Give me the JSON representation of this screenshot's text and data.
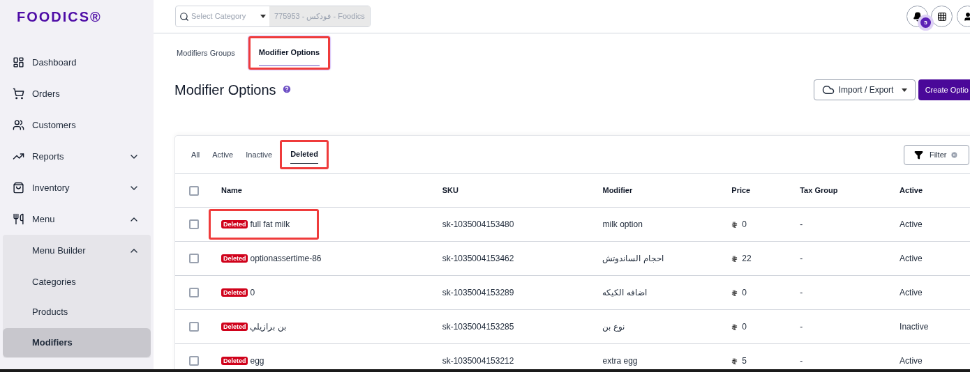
{
  "sidebar": {
    "logo": "FOODICS®",
    "items": [
      {
        "label": "Dashboard",
        "selected": false
      },
      {
        "label": "Orders",
        "selected": false
      },
      {
        "label": "Customers",
        "selected": false
      },
      {
        "label": "Reports",
        "selected": false,
        "expanded": false
      },
      {
        "label": "Inventory",
        "selected": false,
        "expanded": false
      },
      {
        "label": "Menu",
        "selected": false,
        "expanded": true,
        "children": [
          {
            "label": "Menu Builder",
            "selected": false,
            "expanded": true,
            "children": [
              {
                "label": "Categories",
                "selected": false
              },
              {
                "label": "Products",
                "selected": false
              },
              {
                "label": "Modifiers",
                "selected": true
              }
            ]
          }
        ]
      }
    ]
  },
  "header": {
    "category_select": {
      "placeholder": "Select Category"
    },
    "branch": "775953 - فودكس - Foodics",
    "notification_count": "5"
  },
  "tabs": [
    {
      "label": "Modifiers Groups",
      "selected": false,
      "highlighted": false
    },
    {
      "label": "Modifier Options",
      "selected": true,
      "highlighted": true
    }
  ],
  "page_title": "Modifier Options",
  "actions": {
    "import_export": "Import / Export",
    "create": "Create Optio"
  },
  "filter_tabs": [
    {
      "label": "All",
      "selected": false,
      "highlighted": false
    },
    {
      "label": "Active",
      "selected": false,
      "highlighted": false
    },
    {
      "label": "Inactive",
      "selected": false,
      "highlighted": false
    },
    {
      "label": "Deleted",
      "selected": true,
      "highlighted": true
    }
  ],
  "filter_button": "Filter",
  "table": {
    "select_all_checked": false,
    "columns": [
      "Name",
      "SKU",
      "Modifier",
      "Price",
      "Tax Group",
      "Active"
    ],
    "rows": [
      {
        "checked": false,
        "badge": "Deleted",
        "name": "full fat milk",
        "highlighted": true,
        "sku": "sk-1035004153480",
        "modifier": "milk option",
        "price": "0",
        "tax_group": "-",
        "active": "Active"
      },
      {
        "checked": false,
        "badge": "Deleted",
        "name": "optionassertime-86",
        "highlighted": false,
        "sku": "sk-1035004153462",
        "modifier": "احجام الساندوتش",
        "price": "22",
        "tax_group": "-",
        "active": "Active"
      },
      {
        "checked": false,
        "badge": "Deleted",
        "name": "0",
        "highlighted": false,
        "sku": "sk-1035004153289",
        "modifier": "اضافه الكيكه",
        "price": "0",
        "tax_group": "-",
        "active": "Active"
      },
      {
        "checked": false,
        "badge": "Deleted",
        "name": "بن برازيلي",
        "highlighted": false,
        "sku": "sk-1035004153285",
        "modifier": "نوع بن",
        "price": "0",
        "tax_group": "-",
        "active": "Inactive"
      },
      {
        "checked": false,
        "badge": "Deleted",
        "name": "egg",
        "highlighted": false,
        "sku": "sk-1035004153212",
        "modifier": "extra egg",
        "price": "5",
        "tax_group": "-",
        "active": "Active"
      }
    ]
  }
}
